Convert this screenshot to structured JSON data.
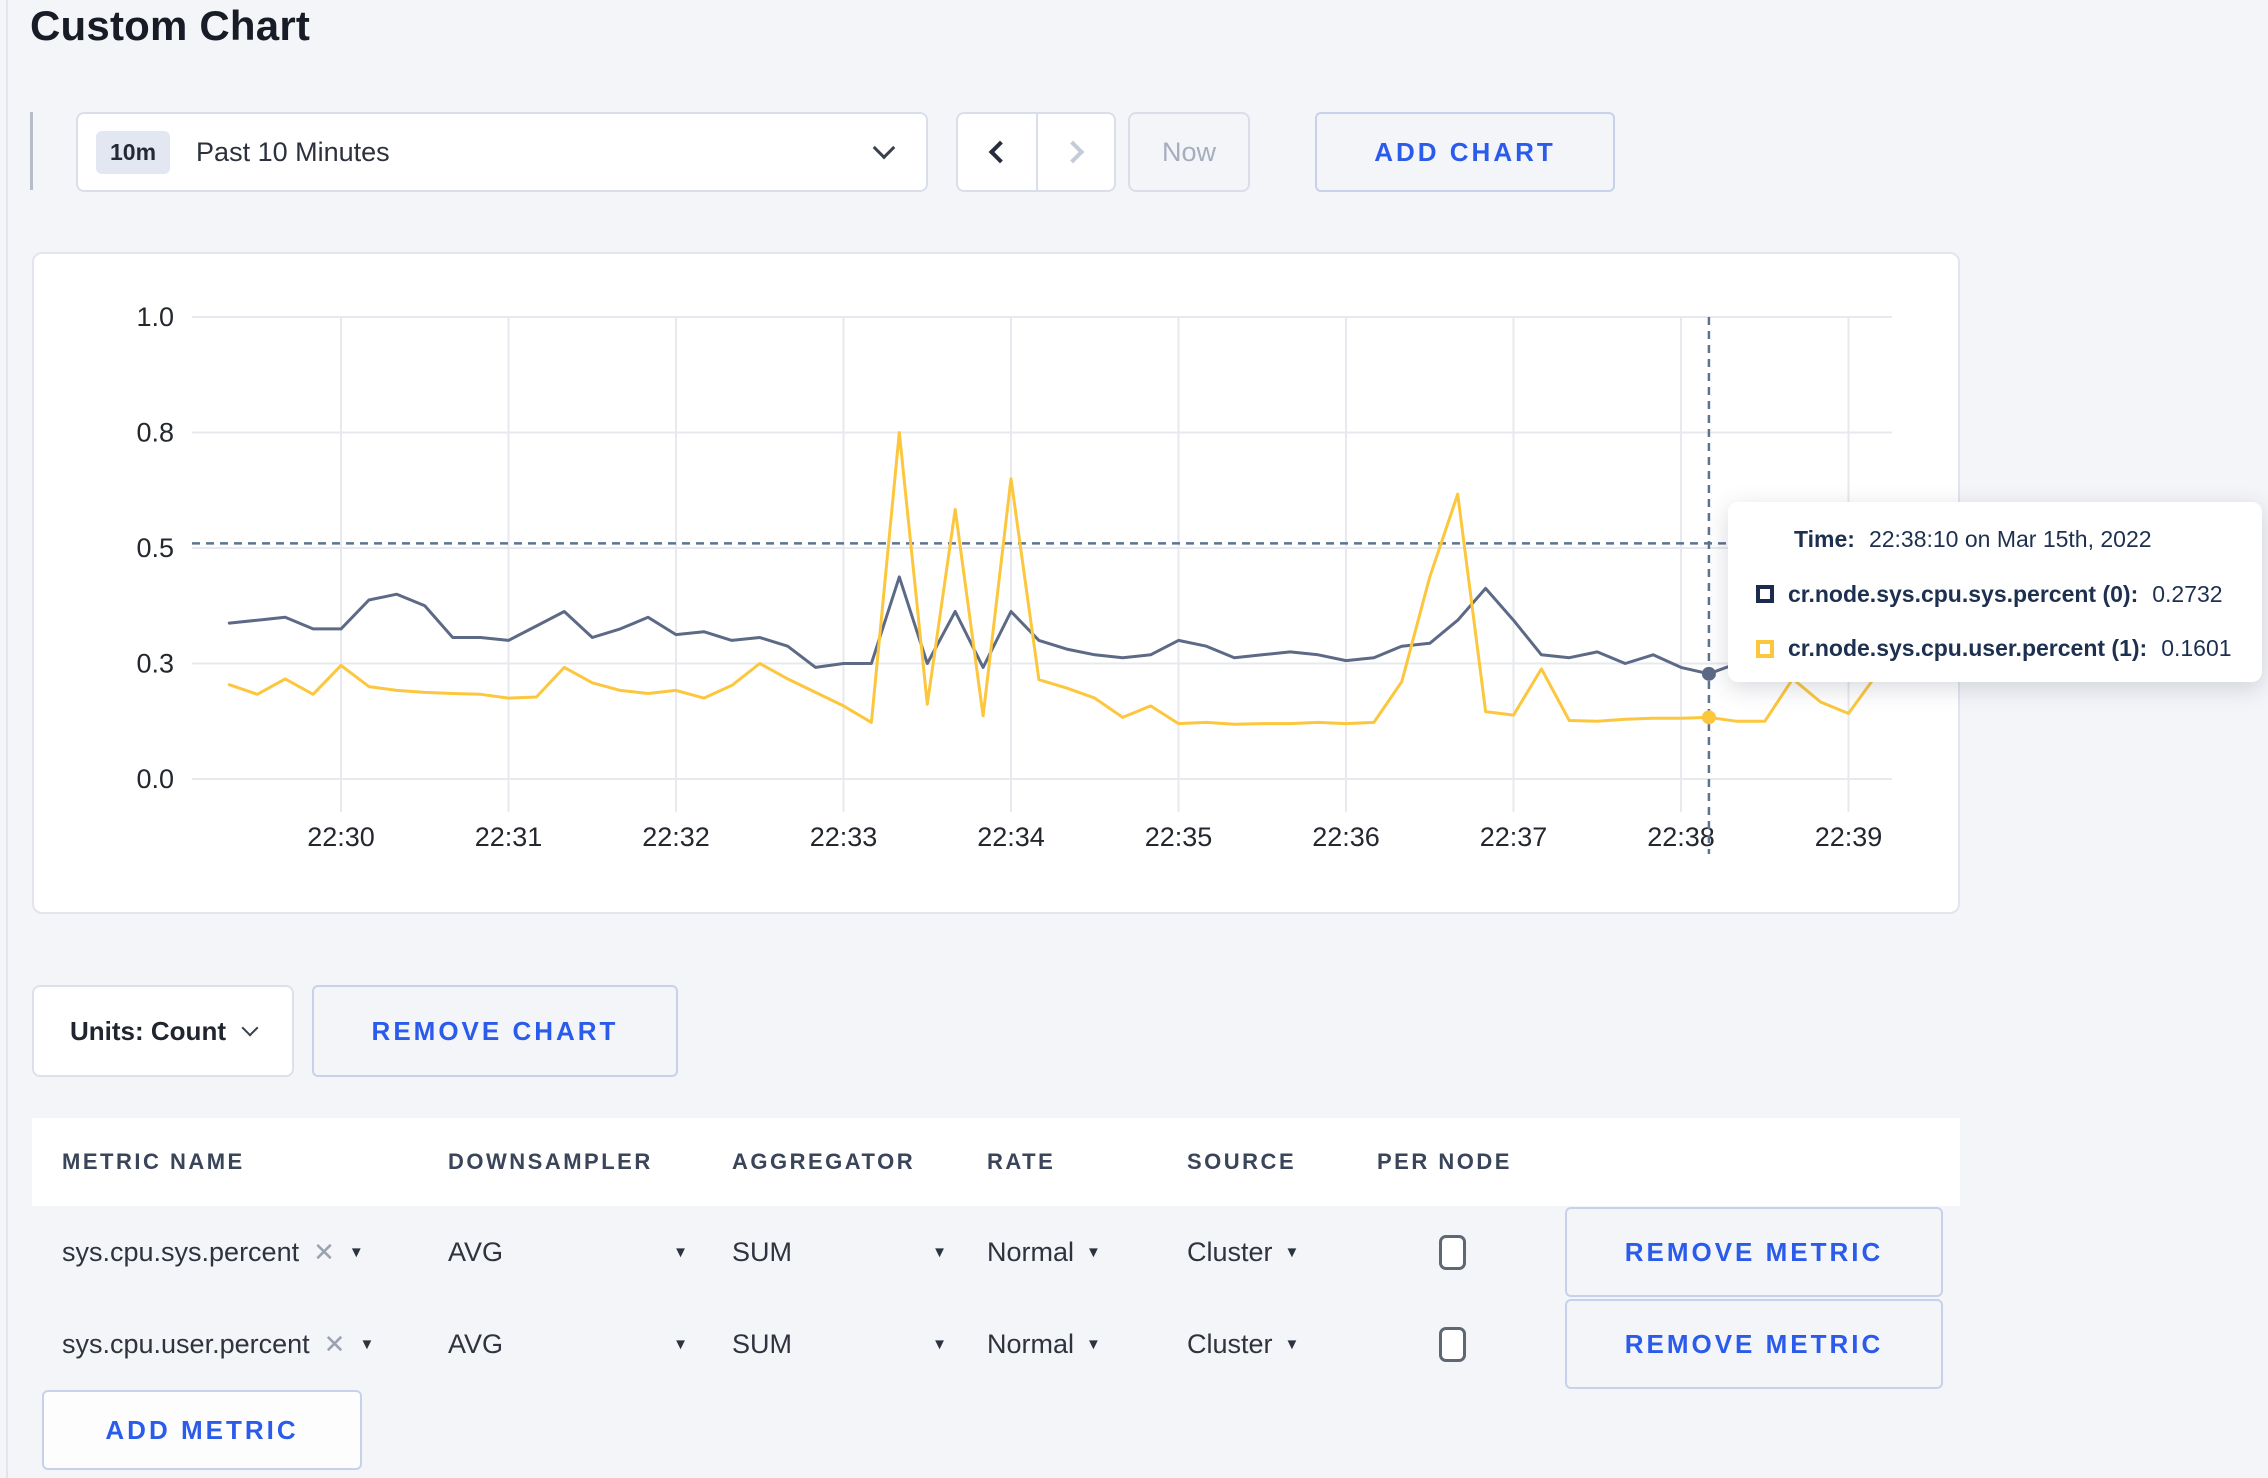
{
  "page": {
    "title": "Custom Chart"
  },
  "toolbar": {
    "time_badge": "10m",
    "time_label": "Past 10 Minutes",
    "now_label": "Now",
    "add_chart_label": "ADD CHART"
  },
  "chart_controls": {
    "units_label": "Units: Count",
    "remove_chart_label": "REMOVE CHART"
  },
  "tooltip": {
    "time_label": "Time:",
    "time_value": "22:38:10 on Mar 15th, 2022",
    "rows": [
      {
        "label": "cr.node.sys.cpu.sys.percent (0):",
        "value": "0.2732",
        "color": "#1b2b4d"
      },
      {
        "label": "cr.node.sys.cpu.user.percent (1):",
        "value": "0.1601",
        "color": "#fcc73d"
      }
    ]
  },
  "chart_data": {
    "type": "line",
    "title": "",
    "xlabel": "",
    "ylabel": "",
    "grid": true,
    "legend_position": "tooltip-only",
    "x_axis": {
      "tick_labels": [
        "22:30",
        "22:31",
        "22:32",
        "22:33",
        "22:34",
        "22:35",
        "22:36",
        "22:37",
        "22:38",
        "22:39"
      ],
      "tick_seconds": [
        60,
        120,
        180,
        240,
        300,
        360,
        420,
        480,
        540,
        600
      ],
      "start_time": "22:29:20",
      "interval_seconds": 10,
      "date": "Mar 15th, 2022"
    },
    "y_axis": {
      "tick_labels": [
        "0.0",
        "0.3",
        "0.5",
        "0.8",
        "1.0"
      ],
      "tick_values": [
        0.0,
        0.3,
        0.5,
        0.8,
        1.0
      ],
      "note": "ticks are equally spaced on screen (non-linear scale)"
    },
    "series": [
      {
        "name": "cr.node.sys.cpu.sys.percent (0)",
        "color": "#5c6a86",
        "values": [
          0.37,
          0.375,
          0.38,
          0.36,
          0.36,
          0.41,
          0.42,
          0.4,
          0.345,
          0.345,
          0.34,
          0.365,
          0.39,
          0.345,
          0.36,
          0.38,
          0.35,
          0.355,
          0.34,
          0.345,
          0.33,
          0.29,
          0.3,
          0.3,
          0.45,
          0.3,
          0.39,
          0.29,
          0.39,
          0.34,
          0.325,
          0.315,
          0.31,
          0.315,
          0.34,
          0.33,
          0.31,
          0.315,
          0.32,
          0.315,
          0.305,
          0.31,
          0.33,
          0.335,
          0.375,
          0.43,
          0.375,
          0.315,
          0.31,
          0.32,
          0.3,
          0.315,
          0.29,
          0.2732,
          0.3,
          0.31,
          0.3,
          0.295,
          0.305,
          0.3
        ]
      },
      {
        "name": "cr.node.sys.cpu.user.percent (1)",
        "color": "#fcc73d",
        "values": [
          0.245,
          0.22,
          0.26,
          0.22,
          0.295,
          0.24,
          0.23,
          0.225,
          0.222,
          0.22,
          0.21,
          0.213,
          0.29,
          0.25,
          0.23,
          0.222,
          0.23,
          0.21,
          0.243,
          0.3,
          0.26,
          0.225,
          0.19,
          0.147,
          0.8,
          0.194,
          0.6,
          0.164,
          0.68,
          0.258,
          0.236,
          0.21,
          0.16,
          0.19,
          0.144,
          0.147,
          0.142,
          0.144,
          0.144,
          0.147,
          0.144,
          0.147,
          0.253,
          0.45,
          0.64,
          0.175,
          0.166,
          0.286,
          0.152,
          0.15,
          0.155,
          0.158,
          0.158,
          0.1601,
          0.15,
          0.15,
          0.26,
          0.2,
          0.17,
          0.27
        ]
      }
    ],
    "crosshair": {
      "time": "22:38:10",
      "seconds": 550,
      "hline_value": 0.512,
      "point_values": [
        0.2732,
        0.1601
      ]
    }
  },
  "metrics_table": {
    "headers": [
      "METRIC NAME",
      "DOWNSAMPLER",
      "AGGREGATOR",
      "RATE",
      "SOURCE",
      "PER NODE"
    ],
    "rows": [
      {
        "metric": "sys.cpu.sys.percent",
        "downsampler": "AVG",
        "aggregator": "SUM",
        "rate": "Normal",
        "source": "Cluster",
        "per_node": false
      },
      {
        "metric": "sys.cpu.user.percent",
        "downsampler": "AVG",
        "aggregator": "SUM",
        "rate": "Normal",
        "source": "Cluster",
        "per_node": false
      }
    ],
    "remove_metric_label": "REMOVE METRIC",
    "add_metric_label": "ADD METRIC"
  },
  "colors": {
    "accent_blue": "#2a5bea",
    "grid_line": "#e7e9ee",
    "axis_text": "#23272e",
    "crosshair": "#5c7490",
    "page_bg": "#f4f5f9",
    "card_bg": "#ffffff"
  }
}
